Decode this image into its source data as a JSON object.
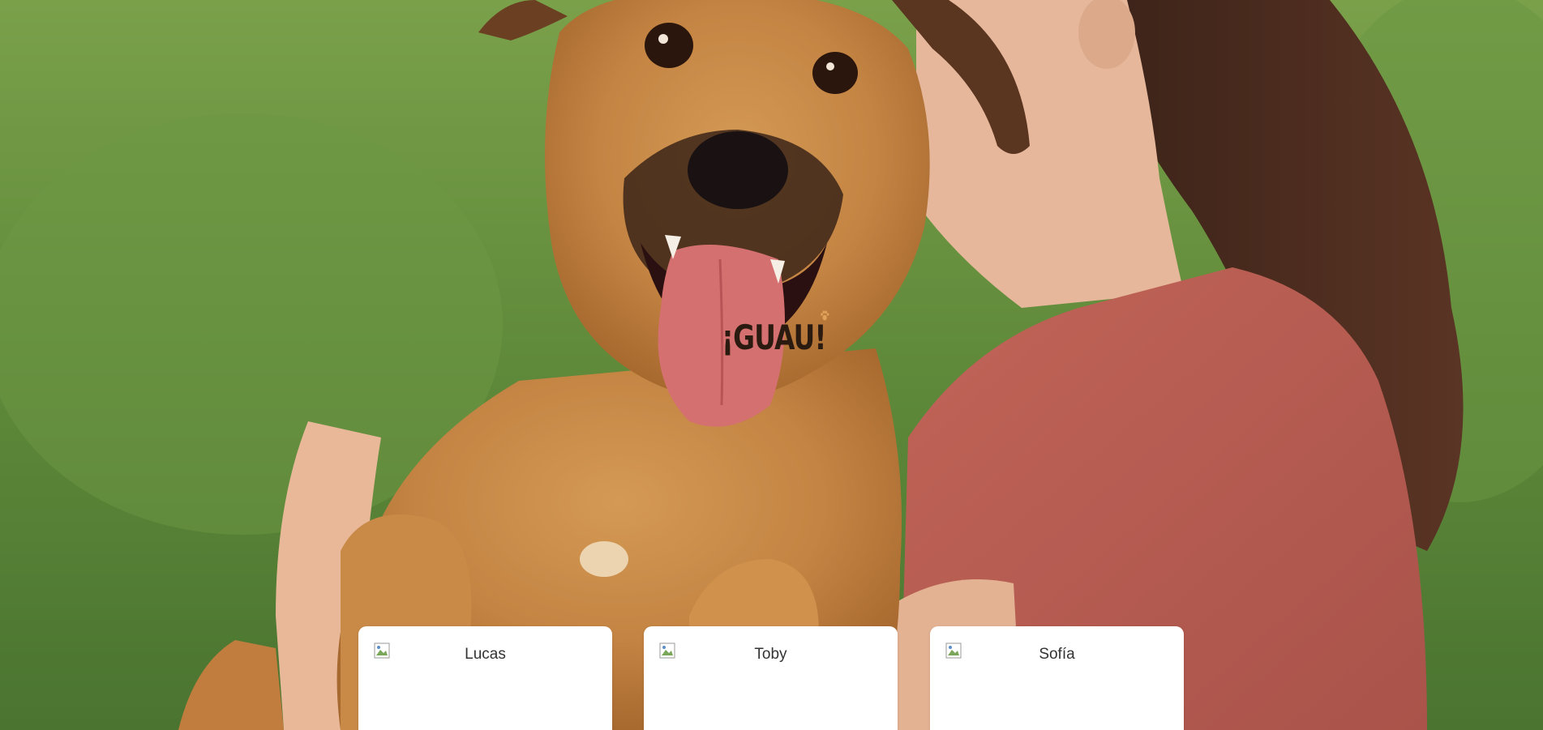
{
  "brand": {
    "logo_text": "¡GUAU!",
    "logo_color": "#2a1a10",
    "accent_color": "#e0a15a"
  },
  "hero": {
    "image": "dog-and-woman-hero-photo",
    "background_color": "#5e8a3c"
  },
  "cards": [
    {
      "name": "Lucas",
      "thumb_icon": "broken-image-icon"
    },
    {
      "name": "Toby",
      "thumb_icon": "broken-image-icon"
    },
    {
      "name": "Sofía",
      "thumb_icon": "broken-image-icon"
    }
  ]
}
